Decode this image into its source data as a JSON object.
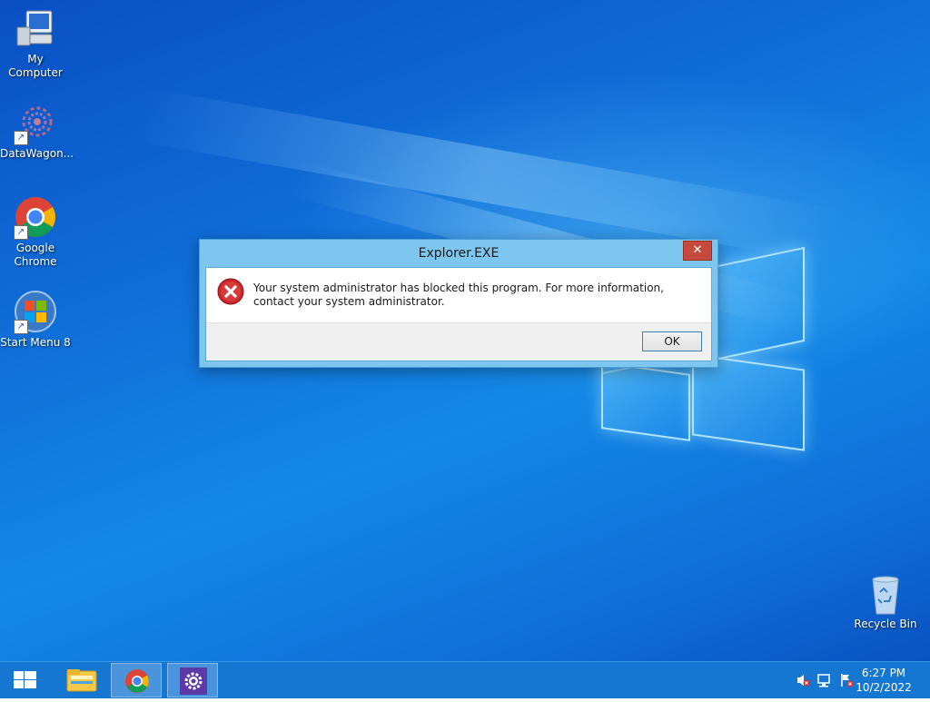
{
  "desktop": {
    "icons": [
      {
        "label": "My Computer"
      },
      {
        "label": "DataWagon..."
      },
      {
        "label": "Google Chrome"
      },
      {
        "label": "Start Menu 8"
      },
      {
        "label": "Recycle Bin"
      }
    ],
    "shortcut_glyph": "↗"
  },
  "dialog": {
    "title": "Explorer.EXE",
    "close_glyph": "✕",
    "message": "Your system administrator has blocked this program. For more information, contact your system administrator.",
    "ok_label": "OK",
    "icon": "error-icon",
    "accent_color": "#7cc6ef"
  },
  "taskbar": {
    "start_icon": "windows-logo-icon",
    "pinned": [
      {
        "icon": "file-explorer-icon",
        "active": false
      },
      {
        "icon": "chrome-icon",
        "active": true
      },
      {
        "icon": "settings-gear-icon",
        "active": true
      }
    ],
    "tray": {
      "icons": [
        "volume-muted-icon",
        "network-icon",
        "action-center-flag-icon"
      ],
      "time": "6:27 PM",
      "date": "10/2/2022"
    },
    "color": "#1677d2"
  }
}
